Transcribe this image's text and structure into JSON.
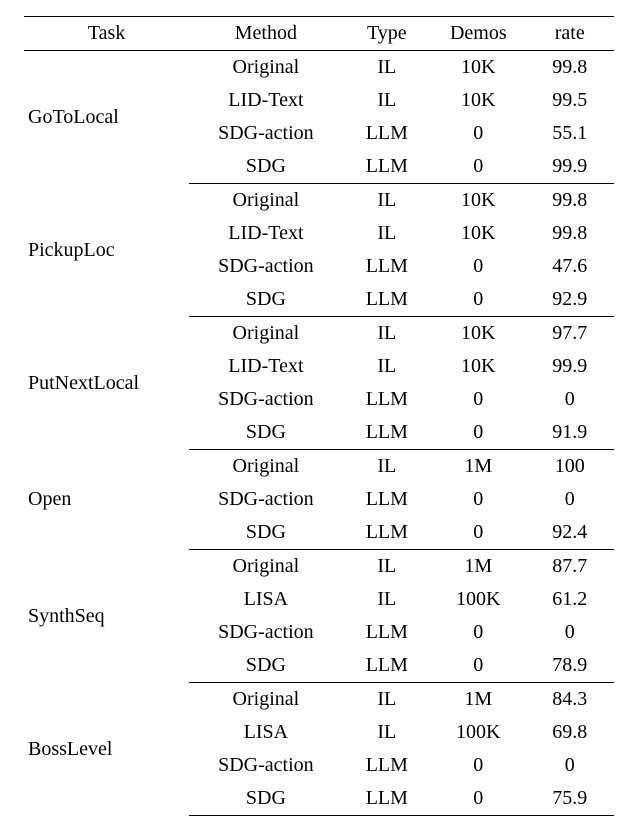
{
  "chart_data": {
    "type": "table",
    "title": "",
    "columns": [
      "Task",
      "Method",
      "Type",
      "Demos",
      "rate"
    ],
    "groups": [
      {
        "task": "GoToLocal",
        "rows": [
          {
            "method": "Original",
            "type": "IL",
            "demos": "10K",
            "rate": "99.8"
          },
          {
            "method": "LID-Text",
            "type": "IL",
            "demos": "10K",
            "rate": "99.5"
          },
          {
            "method": "SDG-action",
            "type": "LLM",
            "demos": "0",
            "rate": "55.1"
          },
          {
            "method": "SDG",
            "type": "LLM",
            "demos": "0",
            "rate": "99.9"
          }
        ]
      },
      {
        "task": "PickupLoc",
        "rows": [
          {
            "method": "Original",
            "type": "IL",
            "demos": "10K",
            "rate": "99.8"
          },
          {
            "method": "LID-Text",
            "type": "IL",
            "demos": "10K",
            "rate": "99.8"
          },
          {
            "method": "SDG-action",
            "type": "LLM",
            "demos": "0",
            "rate": "47.6"
          },
          {
            "method": "SDG",
            "type": "LLM",
            "demos": "0",
            "rate": "92.9"
          }
        ]
      },
      {
        "task": "PutNextLocal",
        "rows": [
          {
            "method": "Original",
            "type": "IL",
            "demos": "10K",
            "rate": "97.7"
          },
          {
            "method": "LID-Text",
            "type": "IL",
            "demos": "10K",
            "rate": "99.9"
          },
          {
            "method": "SDG-action",
            "type": "LLM",
            "demos": "0",
            "rate": "0"
          },
          {
            "method": "SDG",
            "type": "LLM",
            "demos": "0",
            "rate": "91.9"
          }
        ]
      },
      {
        "task": "Open",
        "rows": [
          {
            "method": "Original",
            "type": "IL",
            "demos": "1M",
            "rate": "100"
          },
          {
            "method": "SDG-action",
            "type": "LLM",
            "demos": "0",
            "rate": "0"
          },
          {
            "method": "SDG",
            "type": "LLM",
            "demos": "0",
            "rate": "92.4"
          }
        ]
      },
      {
        "task": "SynthSeq",
        "rows": [
          {
            "method": "Original",
            "type": "IL",
            "demos": "1M",
            "rate": "87.7"
          },
          {
            "method": "LISA",
            "type": "IL",
            "demos": "100K",
            "rate": "61.2"
          },
          {
            "method": "SDG-action",
            "type": "LLM",
            "demos": "0",
            "rate": "0"
          },
          {
            "method": "SDG",
            "type": "LLM",
            "demos": "0",
            "rate": "78.9"
          }
        ]
      },
      {
        "task": "BossLevel",
        "rows": [
          {
            "method": "Original",
            "type": "IL",
            "demos": "1M",
            "rate": "84.3"
          },
          {
            "method": "LISA",
            "type": "IL",
            "demos": "100K",
            "rate": "69.8"
          },
          {
            "method": "SDG-action",
            "type": "LLM",
            "demos": "0",
            "rate": "0"
          },
          {
            "method": "SDG",
            "type": "LLM",
            "demos": "0",
            "rate": "75.9"
          }
        ]
      }
    ]
  }
}
